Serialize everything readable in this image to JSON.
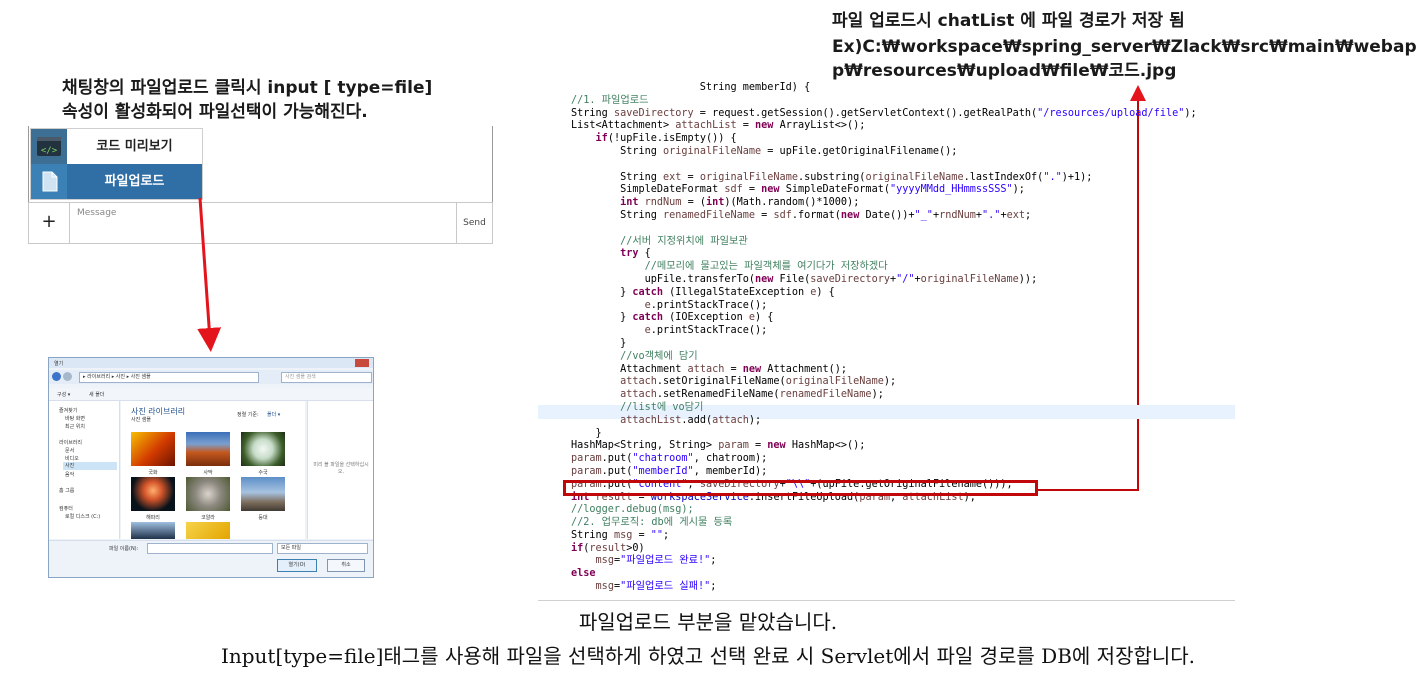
{
  "notes": {
    "left_line1": "채팅창의 파일업로드 클릭시 input [ type=file]",
    "left_line2": "속성이 활성화되어 파일선택이 가능해진다.",
    "right_line1": "파일 업로드시 chatList 에 파일 경로가 저장 됨",
    "right_line2": "Ex)C:₩workspace₩spring_server₩Zlack₩src₩main₩webap",
    "right_line3": "p₩resources₩upload₩file₩코드.jpg"
  },
  "chat": {
    "menu_items": [
      {
        "label": "코드 미리보기",
        "icon": "code-icon"
      },
      {
        "label": "파일업로드",
        "icon": "file-icon"
      }
    ],
    "plus_label": "+",
    "message_placeholder": "Message",
    "send_label": "Send"
  },
  "file_dialog": {
    "title": "열기",
    "path": "▸ 라이브러리 ▸ 사진 ▸ 사진 샘플",
    "search_placeholder": "사진 샘플 검색",
    "toolbar": {
      "organize": "구성 ▾",
      "new_folder": "새 폴더"
    },
    "sidebar": [
      "즐겨찾기",
      "바탕 화면",
      "최근 위치",
      "라이브러리",
      "문서",
      "비디오",
      "사진",
      "음악",
      "홈 그룹",
      "컴퓨터",
      "로컬 디스크 (C:)"
    ],
    "library_title": "사진 라이브러리",
    "library_sub": "사진 샘플",
    "arrange_label": "정렬 기준:",
    "arrange_value": "폴더 ▾",
    "thumbnails": [
      "국화",
      "사막",
      "수국",
      "해파리",
      "코알라",
      "등대",
      "",
      ""
    ],
    "preview_hint": "미리 볼 파일을 선택하십시오.",
    "filename_label": "파일 이름(N):",
    "filetype": "모든 파일",
    "open_button": "열기(O)",
    "cancel_button": "취소"
  },
  "code_lines": [
    [
      [
        "",
        "                     String memberId) {"
      ]
    ],
    [
      [
        "cm",
        "//1. 파일업로드"
      ]
    ],
    [
      [
        "",
        "String "
      ],
      [
        "var",
        "saveDirectory"
      ],
      [
        "",
        " = request.getSession().getServletContext().getRealPath("
      ],
      [
        "str",
        "\"/resources/upload/file\""
      ],
      [
        "",
        ");"
      ]
    ],
    [
      [
        "",
        "List<Attachment> "
      ],
      [
        "var",
        "attachList"
      ],
      [
        "",
        " = "
      ],
      [
        "kw",
        "new"
      ],
      [
        "",
        " ArrayList<>();"
      ]
    ],
    [
      [
        "",
        "    "
      ],
      [
        "kw",
        "if"
      ],
      [
        "",
        "(!upFile.isEmpty()) {"
      ]
    ],
    [
      [
        "",
        "        String "
      ],
      [
        "var",
        "originalFileName"
      ],
      [
        "",
        " = upFile.getOriginalFilename();"
      ]
    ],
    [
      [
        "",
        ""
      ]
    ],
    [
      [
        "",
        "        String "
      ],
      [
        "var",
        "ext"
      ],
      [
        "",
        " = "
      ],
      [
        "var",
        "originalFileName"
      ],
      [
        "",
        ".substring("
      ],
      [
        "var",
        "originalFileName"
      ],
      [
        "",
        ".lastIndexOf("
      ],
      [
        "str",
        "\".\""
      ],
      [
        "",
        ")+1);"
      ]
    ],
    [
      [
        "",
        "        SimpleDateFormat "
      ],
      [
        "var",
        "sdf"
      ],
      [
        "",
        " = "
      ],
      [
        "kw",
        "new"
      ],
      [
        "",
        " SimpleDateFormat("
      ],
      [
        "str",
        "\"yyyyMMdd_HHmmssSSS\""
      ],
      [
        "",
        ");"
      ]
    ],
    [
      [
        "",
        "        "
      ],
      [
        "kw",
        "int"
      ],
      [
        "",
        " "
      ],
      [
        "var",
        "rndNum"
      ],
      [
        "",
        " = ("
      ],
      [
        "kw",
        "int"
      ],
      [
        "",
        ")(Math.random()*1000);"
      ]
    ],
    [
      [
        "",
        "        String "
      ],
      [
        "var",
        "renamedFileName"
      ],
      [
        "",
        " = "
      ],
      [
        "var",
        "sdf"
      ],
      [
        "",
        ".format("
      ],
      [
        "kw",
        "new"
      ],
      [
        "",
        " Date())+"
      ],
      [
        "str",
        "\"_\""
      ],
      [
        "",
        "+"
      ],
      [
        "var",
        "rndNum"
      ],
      [
        "",
        "+"
      ],
      [
        "str",
        "\".\""
      ],
      [
        "",
        "+"
      ],
      [
        "var",
        "ext"
      ],
      [
        "",
        ";"
      ]
    ],
    [
      [
        "",
        ""
      ]
    ],
    [
      [
        "cm",
        "        //서버 지정위치에 파일보관"
      ]
    ],
    [
      [
        "",
        "        "
      ],
      [
        "kw",
        "try"
      ],
      [
        "",
        " {"
      ]
    ],
    [
      [
        "cm",
        "            //메모리에 물고있는 파일객체를 여기다가 저장하겠다"
      ]
    ],
    [
      [
        "",
        "            upFile.transferTo("
      ],
      [
        "kw",
        "new"
      ],
      [
        "",
        " File("
      ],
      [
        "var",
        "saveDirectory"
      ],
      [
        "",
        "+"
      ],
      [
        "str",
        "\"/\""
      ],
      [
        "",
        "+"
      ],
      [
        "var",
        "originalFileName"
      ],
      [
        "",
        "));"
      ]
    ],
    [
      [
        "",
        "        } "
      ],
      [
        "kw",
        "catch"
      ],
      [
        "",
        " (IllegalStateException "
      ],
      [
        "var",
        "e"
      ],
      [
        "",
        ") {"
      ]
    ],
    [
      [
        "",
        "            "
      ],
      [
        "var",
        "e"
      ],
      [
        "",
        ".printStackTrace();"
      ]
    ],
    [
      [
        "",
        "        } "
      ],
      [
        "kw",
        "catch"
      ],
      [
        "",
        " (IOException "
      ],
      [
        "var",
        "e"
      ],
      [
        "",
        ") {"
      ]
    ],
    [
      [
        "",
        "            "
      ],
      [
        "var",
        "e"
      ],
      [
        "",
        ".printStackTrace();"
      ]
    ],
    [
      [
        "",
        "        }"
      ]
    ],
    [
      [
        "cm",
        "        //vo객체에 담기"
      ]
    ],
    [
      [
        "",
        "        Attachment "
      ],
      [
        "var",
        "attach"
      ],
      [
        "",
        " = "
      ],
      [
        "kw",
        "new"
      ],
      [
        "",
        " Attachment();"
      ]
    ],
    [
      [
        "",
        "        "
      ],
      [
        "var",
        "attach"
      ],
      [
        "",
        ".setOriginalFileName("
      ],
      [
        "var",
        "originalFileName"
      ],
      [
        "",
        ");"
      ]
    ],
    [
      [
        "",
        "        "
      ],
      [
        "var",
        "attach"
      ],
      [
        "",
        ".setRenamedFileName("
      ],
      [
        "var",
        "renamedFileName"
      ],
      [
        "",
        ");"
      ]
    ],
    [
      [
        "cm",
        "        //list에 vo담기"
      ]
    ],
    [
      [
        "",
        "        "
      ],
      [
        "var",
        "attachList"
      ],
      [
        "",
        ".add("
      ],
      [
        "var",
        "attach"
      ],
      [
        "",
        ");"
      ]
    ],
    [
      [
        "",
        "    }"
      ]
    ],
    [
      [
        "",
        "HashMap<String, String> "
      ],
      [
        "var",
        "param"
      ],
      [
        "",
        " = "
      ],
      [
        "kw",
        "new"
      ],
      [
        "",
        " HashMap<>();"
      ]
    ],
    [
      [
        "var",
        "param"
      ],
      [
        "",
        ".put("
      ],
      [
        "str",
        "\"chatroom\""
      ],
      [
        "",
        ", chatroom);"
      ]
    ],
    [
      [
        "var",
        "param"
      ],
      [
        "",
        ".put("
      ],
      [
        "str",
        "\"memberId\""
      ],
      [
        "",
        ", memberId);"
      ]
    ],
    [
      [
        "var",
        "param"
      ],
      [
        "",
        ".put("
      ],
      [
        "str",
        "\"content\""
      ],
      [
        "",
        ", "
      ],
      [
        "var",
        "saveDirectory"
      ],
      [
        "",
        "+"
      ],
      [
        "str",
        "\"\\\\\""
      ],
      [
        "",
        "+(upFile.getOriginalFilename()));"
      ]
    ],
    [
      [
        "kw",
        "int"
      ],
      [
        "",
        " "
      ],
      [
        "var",
        "result"
      ],
      [
        "",
        " = "
      ],
      [
        "fld",
        "workspaceService"
      ],
      [
        "",
        ".insertFileUpload("
      ],
      [
        "var",
        "param"
      ],
      [
        "",
        ", "
      ],
      [
        "var",
        "attachList"
      ],
      [
        "",
        ");"
      ]
    ],
    [
      [
        "cm",
        "//logger.debug(msg);"
      ]
    ],
    [
      [
        "cm",
        "//2. 업무로직: db에 게시물 등록"
      ]
    ],
    [
      [
        "",
        "String "
      ],
      [
        "var",
        "msg"
      ],
      [
        "",
        " = "
      ],
      [
        "str",
        "\"\""
      ],
      [
        "",
        ";"
      ]
    ],
    [
      [
        "kw",
        "if"
      ],
      [
        "",
        "("
      ],
      [
        "var",
        "result"
      ],
      [
        "",
        ">0)"
      ]
    ],
    [
      [
        "",
        "    "
      ],
      [
        "var",
        "msg"
      ],
      [
        "",
        "="
      ],
      [
        "str",
        "\"파일업로드 완료!\""
      ],
      [
        "",
        ";"
      ]
    ],
    [
      [
        "kw",
        "else"
      ]
    ],
    [
      [
        "",
        "    "
      ],
      [
        "var",
        "msg"
      ],
      [
        "",
        "="
      ],
      [
        "str",
        "\"파일업로드 실패!\""
      ],
      [
        "",
        ";"
      ]
    ]
  ],
  "caption": {
    "line1": "파일업로드 부분을 맡았습니다.",
    "line2": "Input[type=file]태그를 사용해 파일을 선택하게 하였고 선택 완료 시 Servlet에서 파일 경로를 DB에 저장합니다."
  },
  "colors": {
    "annotation_red": "#e4141c",
    "highlight_box": "#c0080a",
    "menu_active": "#2f6fa6"
  }
}
